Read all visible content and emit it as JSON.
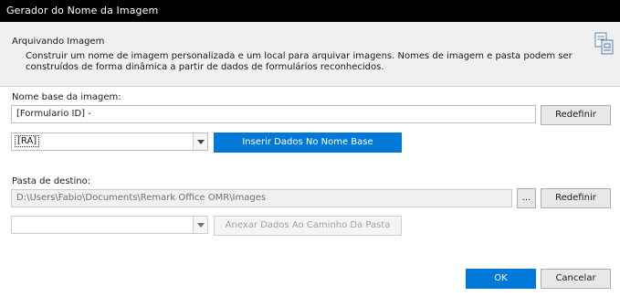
{
  "window": {
    "title": "Gerador do Nome da Imagem"
  },
  "header": {
    "heading": "Arquivando Imagem",
    "description": "Construir um nome de imagem personalizada e um local para arquivar imagens. Nomes de imagem e pasta podem ser construídos de forma dinâmica a partir de dados de formulários reconhecidos.",
    "icon": "form-archive-icon"
  },
  "base_name": {
    "label": "Nome base da imagem:",
    "value": "[Formulario ID] -",
    "reset_label": "Redefinir"
  },
  "data_select": {
    "selected": "[RA]",
    "insert_label": "Inserir Dados No Nome Base"
  },
  "destination": {
    "label": "Pasta de destino:",
    "value": "D:\\Users\\Fabio\\Documents\\Remark Office OMR\\Images",
    "browse_label": "...",
    "reset_label": "Redefinir"
  },
  "path_select": {
    "selected": "",
    "append_label": "Anexar Dados Ao Caminho Da Pasta"
  },
  "footer": {
    "ok_label": "OK",
    "cancel_label": "Cancelar"
  },
  "colors": {
    "titlebar": "#000000",
    "header_bg": "#f0f0f0",
    "accent": "#0078d7"
  }
}
